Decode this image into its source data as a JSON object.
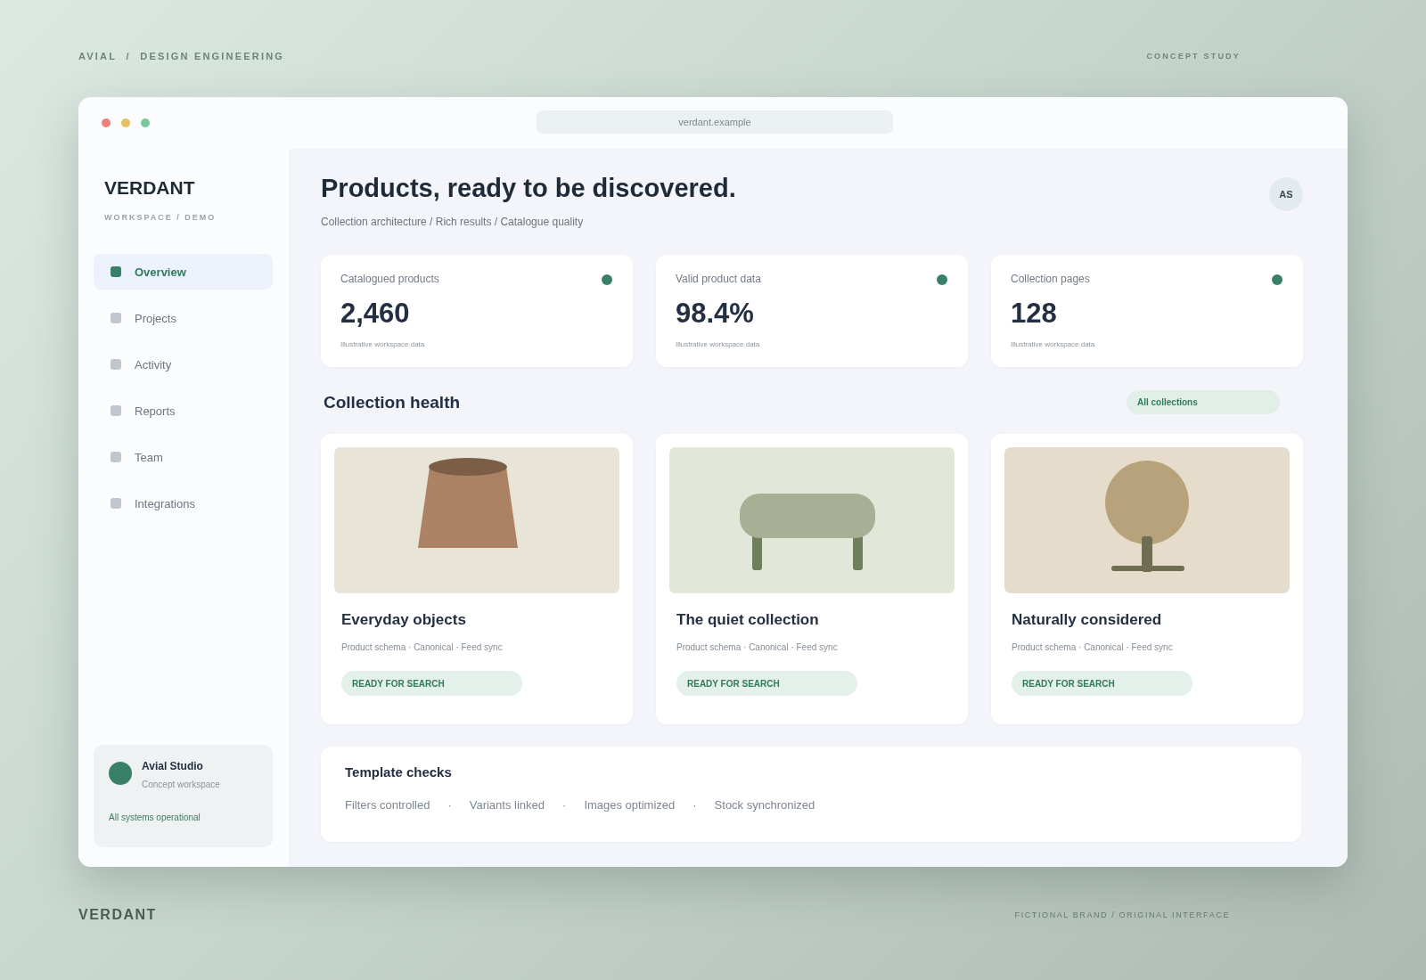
{
  "top_bar": {
    "left": "AVIAL  /  DESIGN ENGINEERING",
    "right": "CONCEPT STUDY"
  },
  "window": {
    "address": "verdant.example"
  },
  "sidebar": {
    "brand": "VERDANT",
    "subtitle": "WORKSPACE / DEMO",
    "items": [
      {
        "label": "Overview",
        "selected": true
      },
      {
        "label": "Projects",
        "selected": false
      },
      {
        "label": "Activity",
        "selected": false
      },
      {
        "label": "Reports",
        "selected": false
      },
      {
        "label": "Team",
        "selected": false
      },
      {
        "label": "Integrations",
        "selected": false
      }
    ],
    "account": {
      "name": "Avial Studio",
      "role": "Concept workspace",
      "status": "All systems operational"
    }
  },
  "header": {
    "title": "Products, ready to be discovered.",
    "breadcrumb": "Collection architecture / Rich results / Catalogue quality",
    "avatar": "AS"
  },
  "stats": [
    {
      "label": "Catalogued products",
      "value": "2,460",
      "note": "Illustrative workspace data",
      "color": "#3a8068"
    },
    {
      "label": "Valid product data",
      "value": "98.4%",
      "note": "Illustrative workspace data",
      "color": "#3a8068"
    },
    {
      "label": "Collection pages",
      "value": "128",
      "note": "Illustrative workspace data",
      "color": "#3a8068"
    }
  ],
  "collections": {
    "title": "Collection health",
    "filter": "All collections",
    "cards": [
      {
        "kind": "vase",
        "title": "Everyday objects",
        "meta": "Product schema · Canonical · Feed sync",
        "status": "READY FOR SEARCH"
      },
      {
        "kind": "bench",
        "title": "The quiet collection",
        "meta": "Product schema · Canonical · Feed sync",
        "status": "READY FOR SEARCH"
      },
      {
        "kind": "lamp",
        "title": "Naturally considered",
        "meta": "Product schema · Canonical · Feed sync",
        "status": "READY FOR SEARCH"
      }
    ]
  },
  "template_checks": {
    "title": "Template checks",
    "items": [
      "Filters controlled",
      "Variants linked",
      "Images optimized",
      "Stock synchronized"
    ],
    "separator": "·"
  },
  "footer": {
    "brand": "VERDANT",
    "note": "FICTIONAL BRAND / ORIGINAL INTERFACE"
  }
}
